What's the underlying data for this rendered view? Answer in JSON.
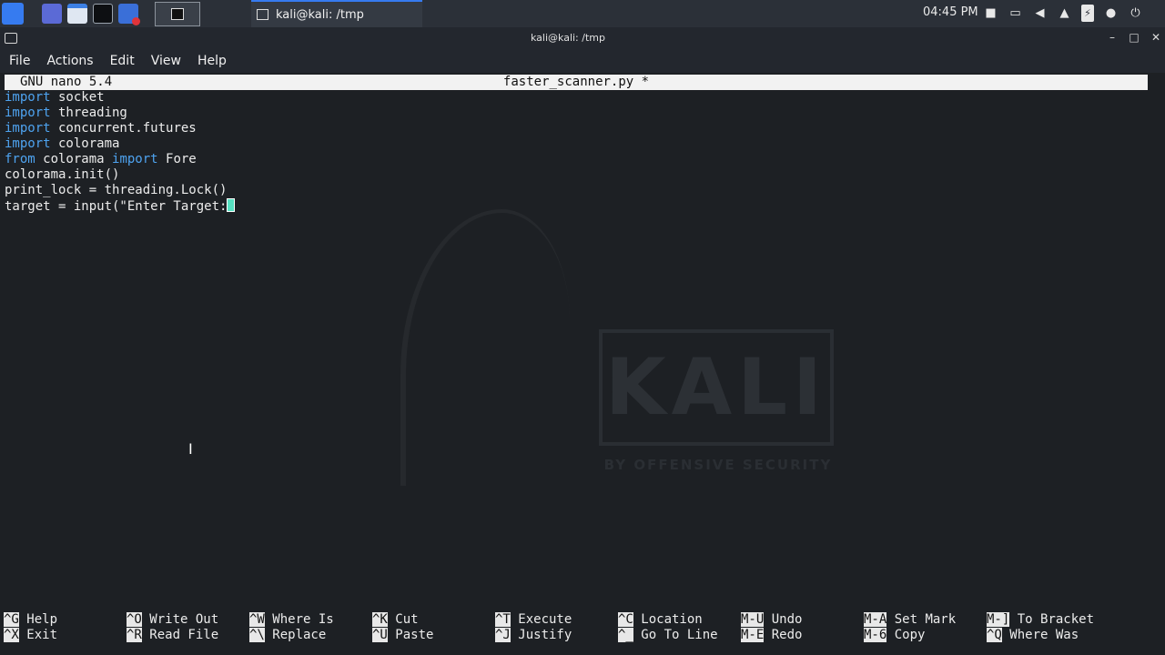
{
  "taskbar": {
    "task_title": "kali@kali: /tmp",
    "clock": "04:45 PM"
  },
  "window": {
    "title": "kali@kali: /tmp",
    "menu": [
      "File",
      "Actions",
      "Edit",
      "View",
      "Help"
    ]
  },
  "nano": {
    "version": "GNU nano 5.4",
    "filename": "faster_scanner.py *",
    "lines": [
      [
        {
          "kw": "import"
        },
        {
          "t": " socket"
        }
      ],
      [
        {
          "kw": "import"
        },
        {
          "t": " threading"
        }
      ],
      [
        {
          "kw": "import"
        },
        {
          "t": " concurrent.futures"
        }
      ],
      [
        {
          "kw": "import"
        },
        {
          "t": " colorama"
        }
      ],
      [
        {
          "kw": "from"
        },
        {
          "t": " colorama "
        },
        {
          "kw": "import"
        },
        {
          "t": " Fore"
        }
      ],
      [
        {
          "t": "colorama.init()"
        }
      ],
      [
        {
          "t": "print_lock = threading.Lock()"
        }
      ],
      [
        {
          "t": "target = input(\"Enter Target:"
        }
      ]
    ],
    "shortcuts": [
      {
        "key": "^G",
        "label": "Help"
      },
      {
        "key": "^X",
        "label": "Exit"
      },
      {
        "key": "^O",
        "label": "Write Out"
      },
      {
        "key": "^R",
        "label": "Read File"
      },
      {
        "key": "^W",
        "label": "Where Is"
      },
      {
        "key": "^\\",
        "label": "Replace"
      },
      {
        "key": "^K",
        "label": "Cut"
      },
      {
        "key": "^U",
        "label": "Paste"
      },
      {
        "key": "^T",
        "label": "Execute"
      },
      {
        "key": "^J",
        "label": "Justify"
      },
      {
        "key": "^C",
        "label": "Location"
      },
      {
        "key": "^_",
        "label": "Go To Line"
      },
      {
        "key": "M-U",
        "label": "Undo"
      },
      {
        "key": "M-E",
        "label": "Redo"
      },
      {
        "key": "M-A",
        "label": "Set Mark"
      },
      {
        "key": "M-6",
        "label": "Copy"
      },
      {
        "key": "M-]",
        "label": "To Bracket"
      },
      {
        "key": "^Q",
        "label": "Where Was"
      }
    ]
  },
  "wallpaper": {
    "logo_text": "KALI",
    "logo_sub": "BY OFFENSIVE SECURITY"
  },
  "colors": {
    "keyword": "#4ea3f0",
    "cursor": "#56e0c1",
    "panel": "#2b3038",
    "accent": "#367bf0"
  }
}
